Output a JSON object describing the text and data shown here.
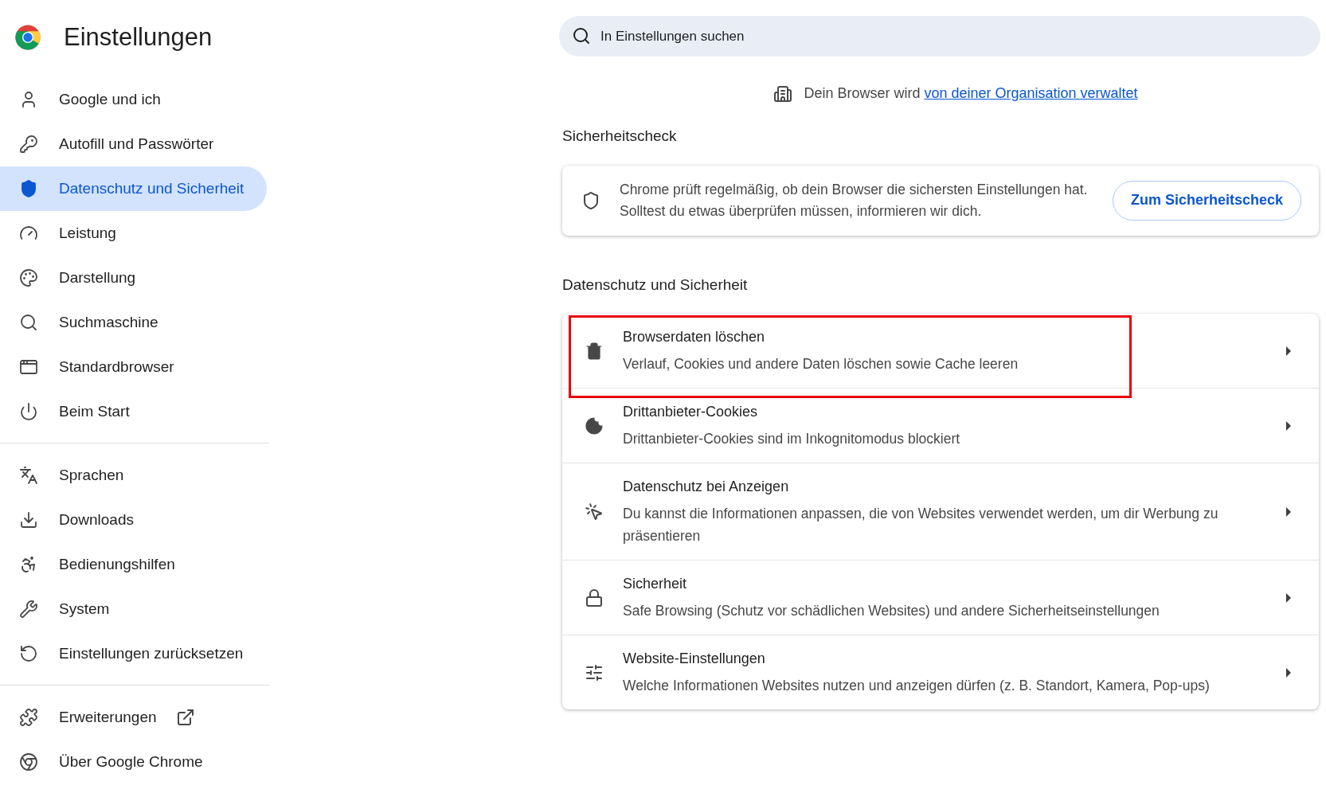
{
  "header": {
    "title": "Einstellungen"
  },
  "sidebar": {
    "groups": [
      [
        {
          "label": "Google und ich",
          "selected": false
        },
        {
          "label": "Autofill und Passwörter",
          "selected": false
        },
        {
          "label": "Datenschutz und Sicherheit",
          "selected": true
        },
        {
          "label": "Leistung",
          "selected": false
        },
        {
          "label": "Darstellung",
          "selected": false
        },
        {
          "label": "Suchmaschine",
          "selected": false
        },
        {
          "label": "Standardbrowser",
          "selected": false
        },
        {
          "label": "Beim Start",
          "selected": false
        }
      ],
      [
        {
          "label": "Sprachen",
          "selected": false
        },
        {
          "label": "Downloads",
          "selected": false
        },
        {
          "label": "Bedienungshilfen",
          "selected": false
        },
        {
          "label": "System",
          "selected": false
        },
        {
          "label": "Einstellungen zurücksetzen",
          "selected": false
        }
      ],
      [
        {
          "label": "Erweiterungen",
          "selected": false,
          "external": true
        },
        {
          "label": "Über Google Chrome",
          "selected": false,
          "external": false
        }
      ]
    ]
  },
  "search": {
    "placeholder": "In Einstellungen suchen"
  },
  "managed": {
    "text": "Dein Browser wird",
    "link": "von deiner Organisation verwaltet"
  },
  "safety_check": {
    "heading": "Sicherheitscheck",
    "text": "Chrome prüft regelmäßig, ob dein Browser die sichersten Einstellungen hat. Solltest du etwas überprüfen müssen, informieren wir dich.",
    "button": "Zum Sicherheitscheck"
  },
  "privacy": {
    "heading": "Datenschutz und Sicherheit",
    "rows": [
      {
        "title": "Browserdaten löschen",
        "subtitle": "Verlauf, Cookies und andere Daten löschen sowie Cache leeren",
        "highlighted": true
      },
      {
        "title": "Drittanbieter-Cookies",
        "subtitle": "Drittanbieter-Cookies sind im Inkognitomodus blockiert",
        "highlighted": false
      },
      {
        "title": "Datenschutz bei Anzeigen",
        "subtitle": "Du kannst die Informationen anpassen, die von Websites verwendet werden, um dir Werbung zu präsentieren",
        "highlighted": false
      },
      {
        "title": "Sicherheit",
        "subtitle": "Safe Browsing (Schutz vor schädlichen Websites) und andere Sicherheitseinstellungen",
        "highlighted": false
      },
      {
        "title": "Website-Einstellungen",
        "subtitle": "Welche Informationen Websites nutzen und anzeigen dürfen (z. B. Standort, Kamera, Pop-ups)",
        "highlighted": false
      }
    ]
  }
}
